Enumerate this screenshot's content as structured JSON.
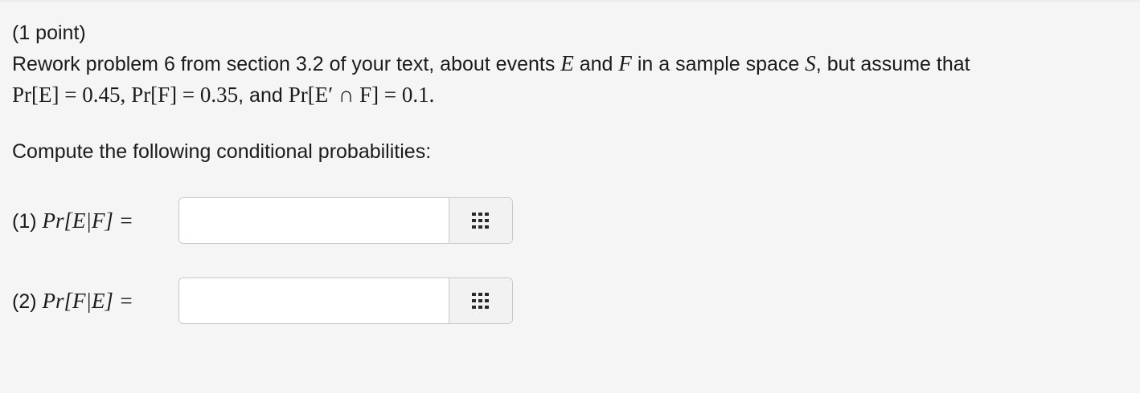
{
  "problem": {
    "points": "(1 point)",
    "line1": {
      "text_a": "Rework problem 6 from section 3.2 of your text, about events ",
      "var_e": "E",
      "text_b": " and ",
      "var_f": "F",
      "text_c": " in a sample space ",
      "var_s": "S",
      "text_d": ", but assume that"
    },
    "line2": {
      "pr_e": "Pr[E] = 0.45",
      "sep1": ",",
      "pr_f": "Pr[F] = 0.35",
      "sep2": ", and",
      "pr_ec_f": "Pr[E′ ∩ F] = 0.1",
      "end": "."
    },
    "instruction": "Compute the following conditional probabilities:"
  },
  "questions": [
    {
      "number": "(1)",
      "expression": "Pr[E|F] =",
      "value": "",
      "placeholder": ""
    },
    {
      "number": "(2)",
      "expression": "Pr[F|E] =",
      "value": "",
      "placeholder": ""
    }
  ],
  "icons": {
    "equation_editor": "grid-icon"
  },
  "colors": {
    "background": "#f5f5f5",
    "text": "#1b1b1b",
    "input_border": "#c9c9c9",
    "icon": "#2a2a2a"
  }
}
